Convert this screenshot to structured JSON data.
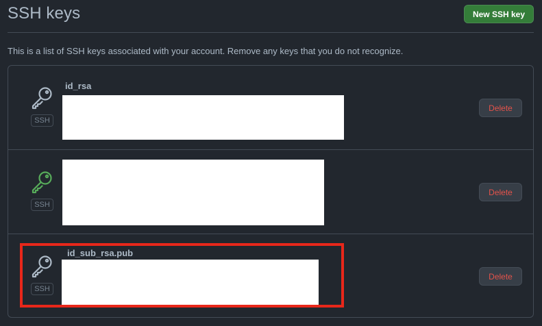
{
  "header": {
    "title": "SSH keys",
    "new_key_label": "New SSH key"
  },
  "intro_text": "This is a list of SSH keys associated with your account. Remove any keys that you do not recognize.",
  "keys": [
    {
      "name": "id_rsa",
      "type_label": "SSH",
      "icon": "key-icon",
      "icon_color": "#adbac7",
      "delete_label": "Delete"
    },
    {
      "name": "",
      "type_label": "SSH",
      "icon": "key-icon",
      "icon_color": "#57ab5a",
      "delete_label": "Delete"
    },
    {
      "name": "id_sub_rsa.pub",
      "type_label": "SSH",
      "icon": "key-icon",
      "icon_color": "#adbac7",
      "delete_label": "Delete"
    }
  ],
  "colors": {
    "background": "#22272e",
    "primary_button": "#347d39",
    "danger_text": "#e5534b",
    "highlight": "#e8271a"
  }
}
